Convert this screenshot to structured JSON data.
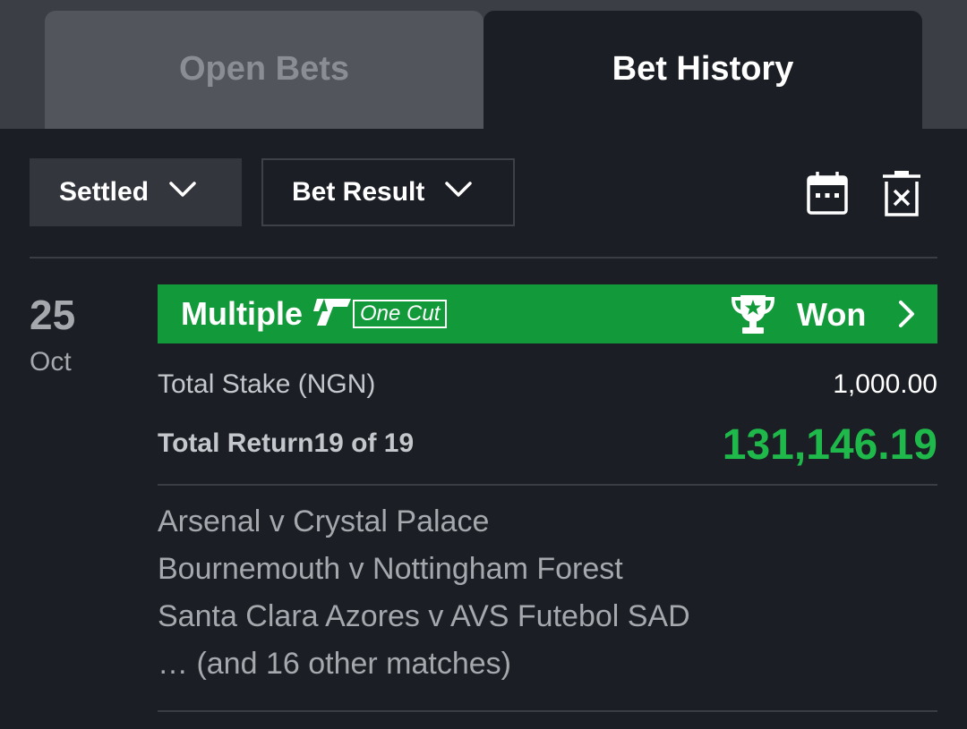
{
  "tabs": {
    "open_bets": "Open Bets",
    "bet_history": "Bet History",
    "active": "bet_history"
  },
  "filters": {
    "status": "Settled",
    "result": "Bet Result"
  },
  "icons": {
    "calendar": "calendar-icon",
    "delete": "clear-trash-icon",
    "chevron": "chevron-down-icon",
    "trophy": "trophy-icon",
    "arrow": "chevron-right-icon"
  },
  "bet": {
    "date_day": "25",
    "date_month": "Oct",
    "type": "Multiple",
    "badge": "One Cut",
    "status": "Won",
    "stake_label": "Total Stake (NGN)",
    "stake_value": "1,000.00",
    "return_label": "Total Return",
    "return_count": "19 of 19",
    "return_value": "131,146.19",
    "matches": [
      "Arsenal v Crystal Palace",
      "Bournemouth v Nottingham Forest",
      "Santa Clara Azores v AVS Futebol SAD",
      "… (and 16 other matches)"
    ]
  },
  "colors": {
    "background": "#1b1e24",
    "won_green": "#129a3a",
    "return_green": "#1fb84a",
    "tab_inactive": "#52555c"
  }
}
